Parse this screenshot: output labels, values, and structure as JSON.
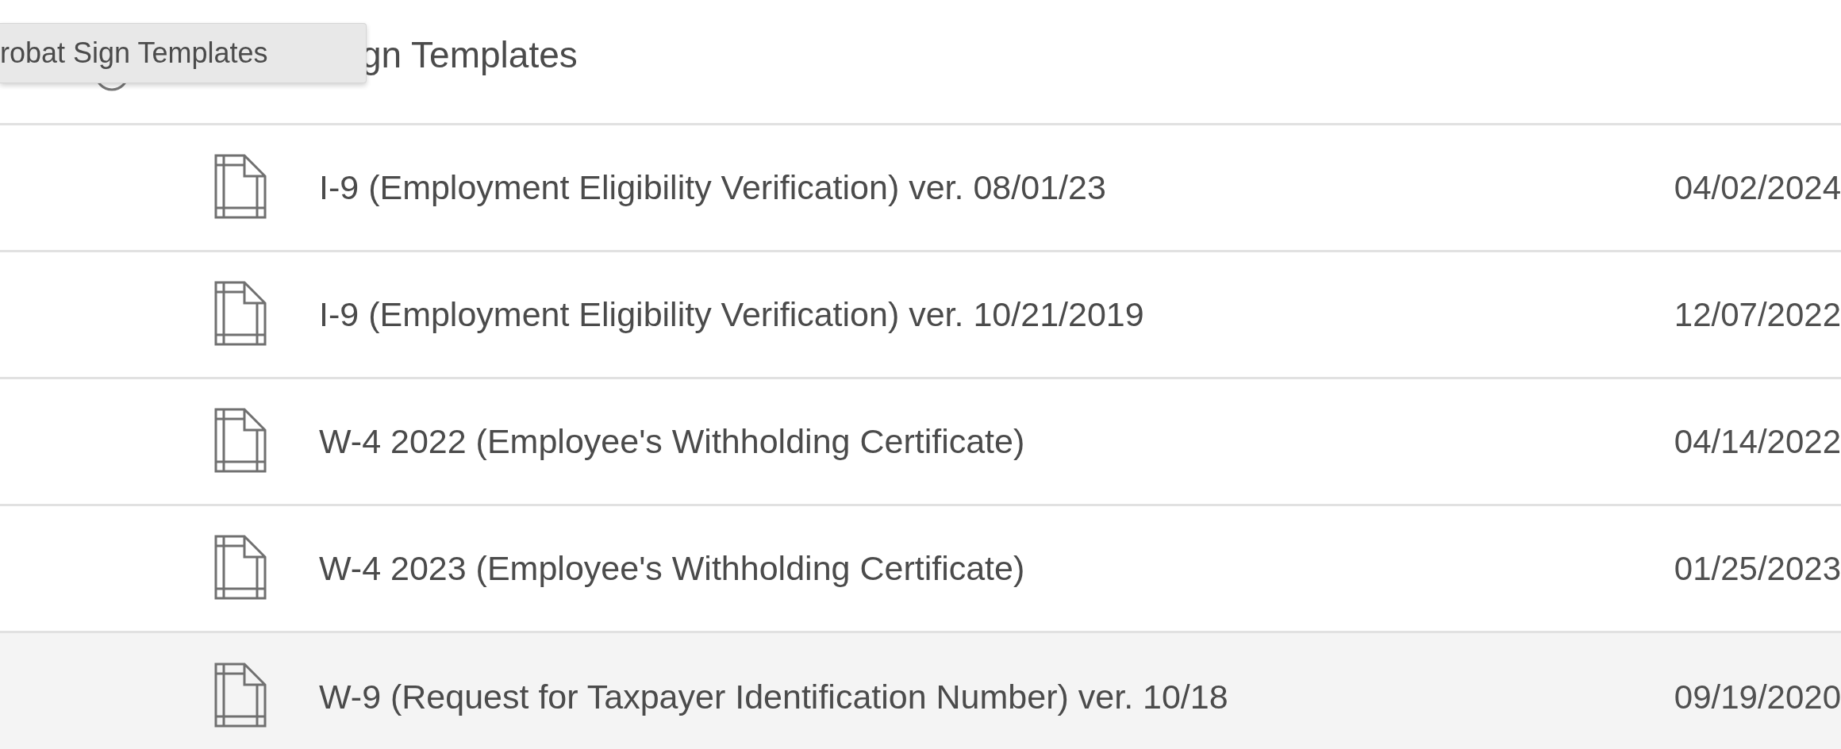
{
  "header": {
    "title": "gn Templates"
  },
  "tooltip": {
    "text": "robat Sign Templates"
  },
  "rows": [
    {
      "name": "I-9 (Employment Eligibility Verification) ver. 08/01/23",
      "date": "04/02/2024",
      "selected": false
    },
    {
      "name": "I-9 (Employment Eligibility Verification) ver. 10/21/2019",
      "date": "12/07/2022",
      "selected": false
    },
    {
      "name": "W-4 2022 (Employee's Withholding Certificate)",
      "date": "04/14/2022",
      "selected": false
    },
    {
      "name": "W-4 2023 (Employee's Withholding Certificate)",
      "date": "01/25/2023",
      "selected": false
    },
    {
      "name": "W-9 (Request for Taxpayer Identification Number) ver. 10/18",
      "date": "09/19/2020",
      "selected": true
    }
  ]
}
